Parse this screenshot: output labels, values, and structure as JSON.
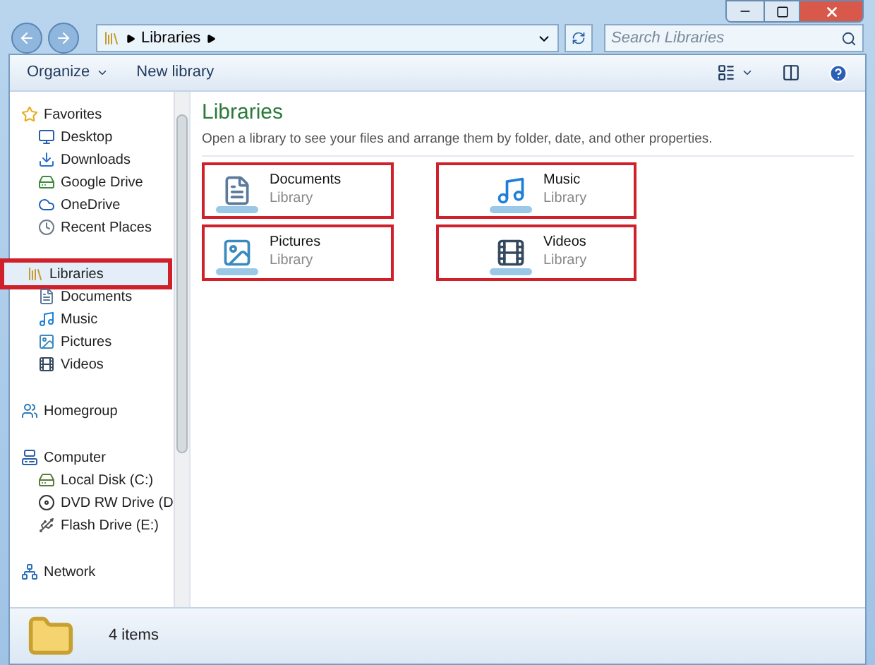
{
  "address_bar": {
    "crumbs": [
      "Libraries"
    ]
  },
  "search": {
    "placeholder": "Search Libraries"
  },
  "toolbar": {
    "items": [
      "Organize",
      "New library"
    ]
  },
  "sidebar": {
    "groups": [
      {
        "label": "Favorites",
        "kind": "star",
        "highlighted": false,
        "children": [
          {
            "label": "Desktop",
            "kind": "desktop",
            "highlighted": false
          },
          {
            "label": "Downloads",
            "kind": "downloads",
            "highlighted": false
          },
          {
            "label": "Google Drive",
            "kind": "drive",
            "highlighted": false
          },
          {
            "label": "OneDrive",
            "kind": "cloud",
            "highlighted": false
          },
          {
            "label": "Recent Places",
            "kind": "recent",
            "highlighted": false
          }
        ]
      },
      {
        "label": "Libraries",
        "kind": "library",
        "highlighted": true,
        "children": [
          {
            "label": "Documents",
            "kind": "documents",
            "highlighted": false
          },
          {
            "label": "Music",
            "kind": "music",
            "highlighted": false
          },
          {
            "label": "Pictures",
            "kind": "pictures",
            "highlighted": false
          },
          {
            "label": "Videos",
            "kind": "videos",
            "highlighted": false
          }
        ]
      },
      {
        "label": "Homegroup",
        "kind": "homegroup",
        "highlighted": false
      },
      {
        "label": "Computer",
        "kind": "computer",
        "highlighted": false,
        "children": [
          {
            "label": "Local Disk (C:)",
            "kind": "disk",
            "highlighted": false
          },
          {
            "label": "DVD RW Drive (D",
            "kind": "dvd",
            "highlighted": false
          },
          {
            "label": "Flash Drive (E:)",
            "kind": "flash",
            "highlighted": false
          }
        ]
      },
      {
        "label": "Network",
        "kind": "network",
        "highlighted": false
      }
    ]
  },
  "content": {
    "title": "Libraries",
    "description": "Open a library to see your files and arrange them by folder, date, and other properties.",
    "tiles": [
      {
        "name": "Documents",
        "type": "Library",
        "kind": "documents",
        "highlighted": true
      },
      {
        "name": "Music",
        "type": "Library",
        "kind": "music",
        "highlighted": true
      },
      {
        "name": "Pictures",
        "type": "Library",
        "kind": "pictures",
        "highlighted": true
      },
      {
        "name": "Videos",
        "type": "Library",
        "kind": "videos",
        "highlighted": true
      }
    ]
  },
  "status_bar": {
    "text": "4 items"
  }
}
